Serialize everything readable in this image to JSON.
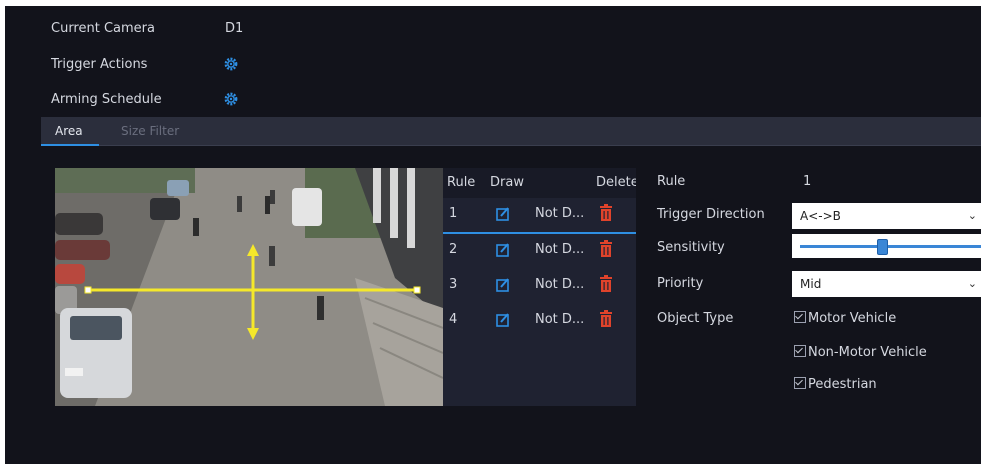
{
  "info": {
    "current_camera_label": "Current Camera",
    "current_camera_value": "D1",
    "trigger_actions_label": "Trigger Actions",
    "arming_schedule_label": "Arming Schedule"
  },
  "tabs": [
    {
      "label": "Area",
      "active": true
    },
    {
      "label": "Size Filter",
      "active": false
    }
  ],
  "rules_table": {
    "headers": [
      "Rule",
      "Draw",
      "Delete"
    ],
    "rows": [
      {
        "rule": "1",
        "status": "Not D...",
        "selected": true
      },
      {
        "rule": "2",
        "status": "Not D...",
        "selected": false
      },
      {
        "rule": "3",
        "status": "Not D...",
        "selected": false
      },
      {
        "rule": "4",
        "status": "Not D...",
        "selected": false
      }
    ]
  },
  "properties": {
    "rule_label": "Rule",
    "rule_value": "1",
    "trigger_direction_label": "Trigger Direction",
    "trigger_direction_value": "A<->B",
    "sensitivity_label": "Sensitivity",
    "sensitivity_level": 0.48,
    "priority_label": "Priority",
    "priority_value": "Mid",
    "object_type_label": "Object Type",
    "object_types": [
      {
        "label": "Motor Vehicle",
        "checked": true
      },
      {
        "label": "Non-Motor Vehicle",
        "checked": true
      },
      {
        "label": "Pedestrian",
        "checked": true
      }
    ]
  },
  "icons": {
    "gear": "gear-icon",
    "draw": "edit-icon",
    "delete": "trash-icon",
    "dropdown": "chevron-down-icon"
  },
  "colors": {
    "accent": "#2e8fe3",
    "delete_icon": "#e0432b",
    "line_overlay": "#f5e82a",
    "background": "#12131b"
  }
}
